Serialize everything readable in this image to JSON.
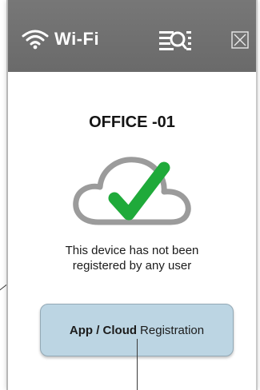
{
  "header": {
    "title": "Wi-Fi",
    "wifi_icon": "wifi-icon",
    "scan_icon": "network-scan-icon",
    "close_icon": "close-icon",
    "bar_color": "#707070"
  },
  "main": {
    "ssid": "OFFICE -01",
    "status_icon": "cloud-check-icon",
    "message_line1": "This device has not been",
    "message_line2": "registered by any user",
    "check_color": "#1faa3a",
    "cloud_color": "#9b9b9b"
  },
  "registration_button": {
    "label_bold": "App / Cloud",
    "label_rest": "Registration",
    "background": "#bcd5e3"
  }
}
